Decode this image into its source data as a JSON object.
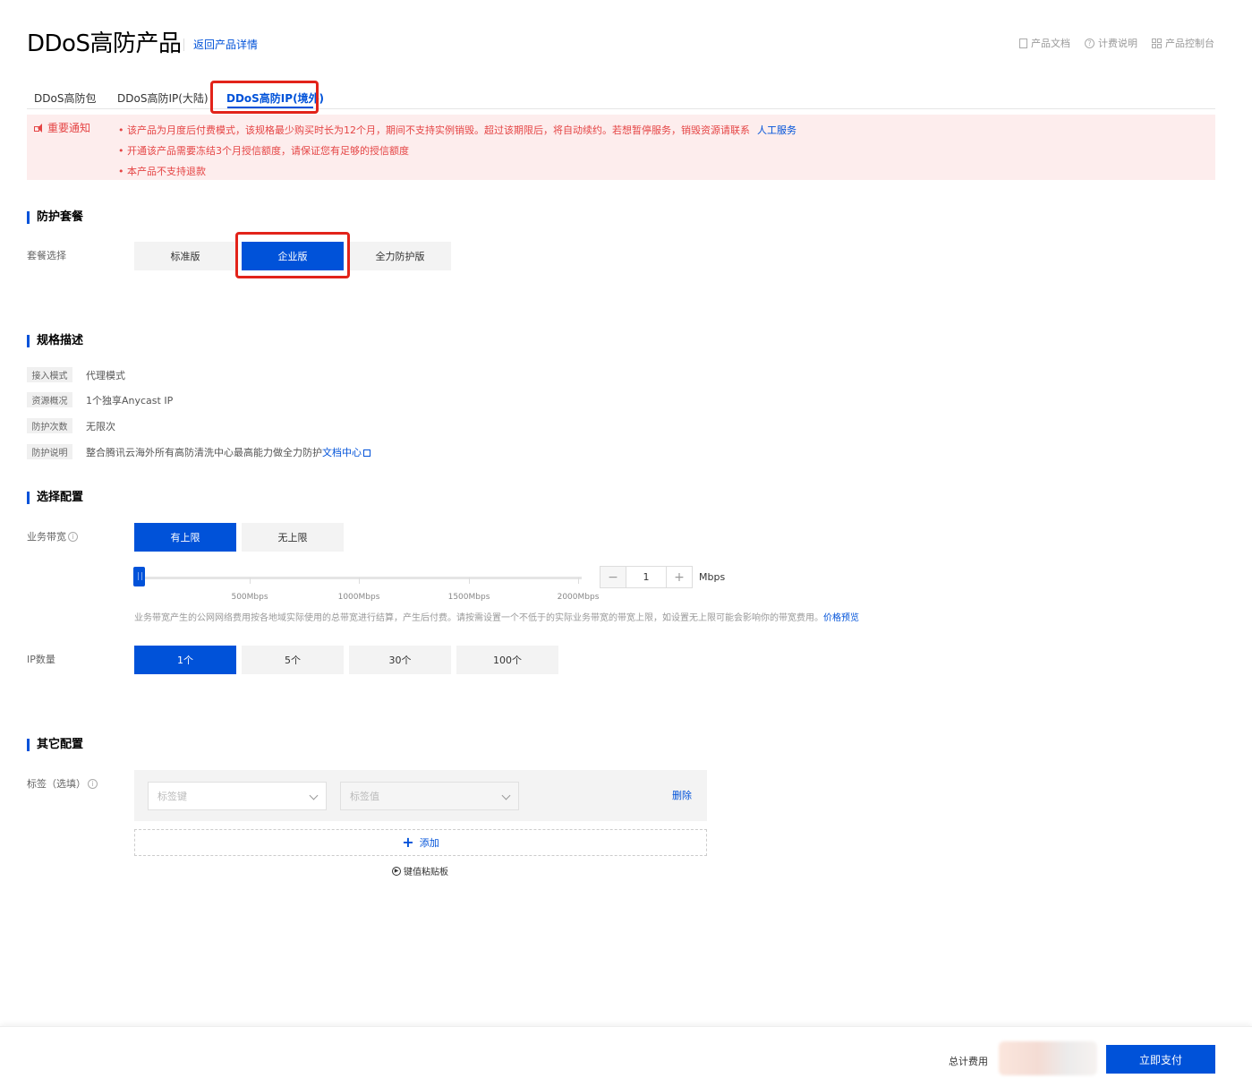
{
  "header": {
    "title": "DDoS高防产品",
    "back_link": "返回产品详情",
    "links": [
      {
        "icon": "doc-icon",
        "label": "产品文档"
      },
      {
        "icon": "help-icon",
        "label": "计费说明"
      },
      {
        "icon": "grid-icon",
        "label": "产品控制台"
      }
    ]
  },
  "tabs": [
    {
      "label": "DDoS高防包"
    },
    {
      "label": "DDoS高防IP(大陆)"
    },
    {
      "label": "DDoS高防IP(境外)",
      "active": true
    }
  ],
  "notice": {
    "label": "重要通知",
    "items": [
      {
        "text": "该产品为月度后付费模式，该规格最少购买时长为12个月，期间不支持实例销毁。超过该期限后，将自动续约。若想暂停服务，销毁资源请联系",
        "link": "人工服务"
      },
      {
        "text": "开通该产品需要冻结3个月授信额度，请保证您有足够的授信额度"
      },
      {
        "text": "本产品不支持退款"
      }
    ]
  },
  "package": {
    "section_title": "防护套餐",
    "label": "套餐选择",
    "options": [
      "标准版",
      "企业版",
      "全力防护版"
    ],
    "selected": "企业版"
  },
  "spec": {
    "section_title": "规格描述",
    "rows": [
      {
        "tag": "接入模式",
        "value": "代理模式"
      },
      {
        "tag": "资源概况",
        "value": "1个独享Anycast IP"
      },
      {
        "tag": "防护次数",
        "value": "无限次"
      },
      {
        "tag": "防护说明",
        "value": "整合腾讯云海外所有高防清洗中心最高能力做全力防护",
        "link": "文档中心"
      }
    ]
  },
  "config": {
    "section_title": "选择配置",
    "bandwidth_label": "业务带宽",
    "bandwidth_options": [
      "有上限",
      "无上限"
    ],
    "bandwidth_selected": "有上限",
    "slider": {
      "ticks": [
        "500Mbps",
        "1000Mbps",
        "1500Mbps",
        "2000Mbps"
      ],
      "value": 1,
      "unit": "Mbps",
      "minus": "−",
      "plus": "+"
    },
    "hint": "业务带宽产生的公网网络费用按各地域实际使用的总带宽进行结算，产生后付费。请按需设置一个不低于的实际业务带宽的带宽上限，如设置无上限可能会影响你的带宽费用。",
    "hint_link": "价格预览",
    "ip_label": "IP数量",
    "ip_options": [
      "1个",
      "5个",
      "30个",
      "100个"
    ],
    "ip_selected": "1个"
  },
  "other": {
    "section_title": "其它配置",
    "tag_label": "标签（选填）",
    "key_placeholder": "标签键",
    "value_placeholder": "标签值",
    "delete": "删除",
    "add": "添加",
    "clipboard": "键值粘贴板"
  },
  "footer": {
    "total_label": "总计费用",
    "pay_button": "立即支付"
  },
  "colors": {
    "primary": "#0052d9",
    "notice_bg": "#fdeded",
    "notice_text": "#e54545",
    "highlight_box": "#e2231a"
  }
}
